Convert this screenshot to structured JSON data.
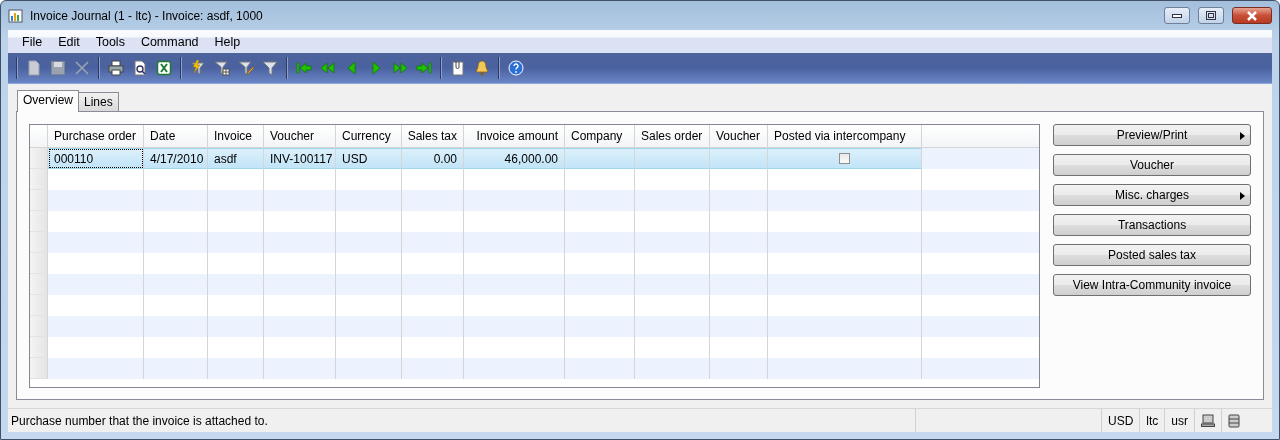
{
  "window": {
    "title": "Invoice Journal (1 - ltc) - Invoice: asdf, 1000"
  },
  "menu": [
    "File",
    "Edit",
    "Tools",
    "Command",
    "Help"
  ],
  "tabs": [
    {
      "label": "Overview",
      "selected": true
    },
    {
      "label": "Lines",
      "selected": false
    }
  ],
  "table": {
    "columns": [
      {
        "label": "Purchase order",
        "kind": "text"
      },
      {
        "label": "Date",
        "kind": "text"
      },
      {
        "label": "Invoice",
        "kind": "text"
      },
      {
        "label": "Voucher",
        "kind": "text"
      },
      {
        "label": "Currency",
        "kind": "text"
      },
      {
        "label": "Sales tax",
        "kind": "number"
      },
      {
        "label": "Invoice amount",
        "kind": "number"
      },
      {
        "label": "Company",
        "kind": "text"
      },
      {
        "label": "Sales order",
        "kind": "text"
      },
      {
        "label": "Voucher",
        "kind": "text"
      },
      {
        "label": "Posted via intercompany",
        "kind": "check"
      }
    ],
    "rows": [
      {
        "selected": true,
        "cells": [
          {
            "text": "000110",
            "focused": true
          },
          {
            "text": "4/17/2010",
            "focused": false
          },
          {
            "text": "asdf",
            "focused": false
          },
          {
            "text": "INV-100117",
            "focused": false
          },
          {
            "text": "USD",
            "focused": false
          },
          {
            "text": "0.00",
            "focused": false
          },
          {
            "text": "46,000.00",
            "focused": false
          },
          {
            "focused": false
          },
          {
            "focused": false
          },
          {
            "focused": false
          },
          {
            "checked": false,
            "focused": false
          }
        ]
      }
    ]
  },
  "buttons": [
    {
      "label": "Preview/Print",
      "submenu": true
    },
    {
      "label": "Voucher",
      "submenu": false
    },
    {
      "label": "Misc. charges",
      "submenu": true
    },
    {
      "label": "Transactions",
      "submenu": false
    },
    {
      "label": "Posted sales tax",
      "submenu": false
    },
    {
      "label": "View Intra-Community invoice",
      "submenu": false
    }
  ],
  "status_bar": {
    "message": "Purchase number that the invoice is attached to.",
    "fields": [
      "USD",
      "ltc",
      "usr"
    ]
  }
}
